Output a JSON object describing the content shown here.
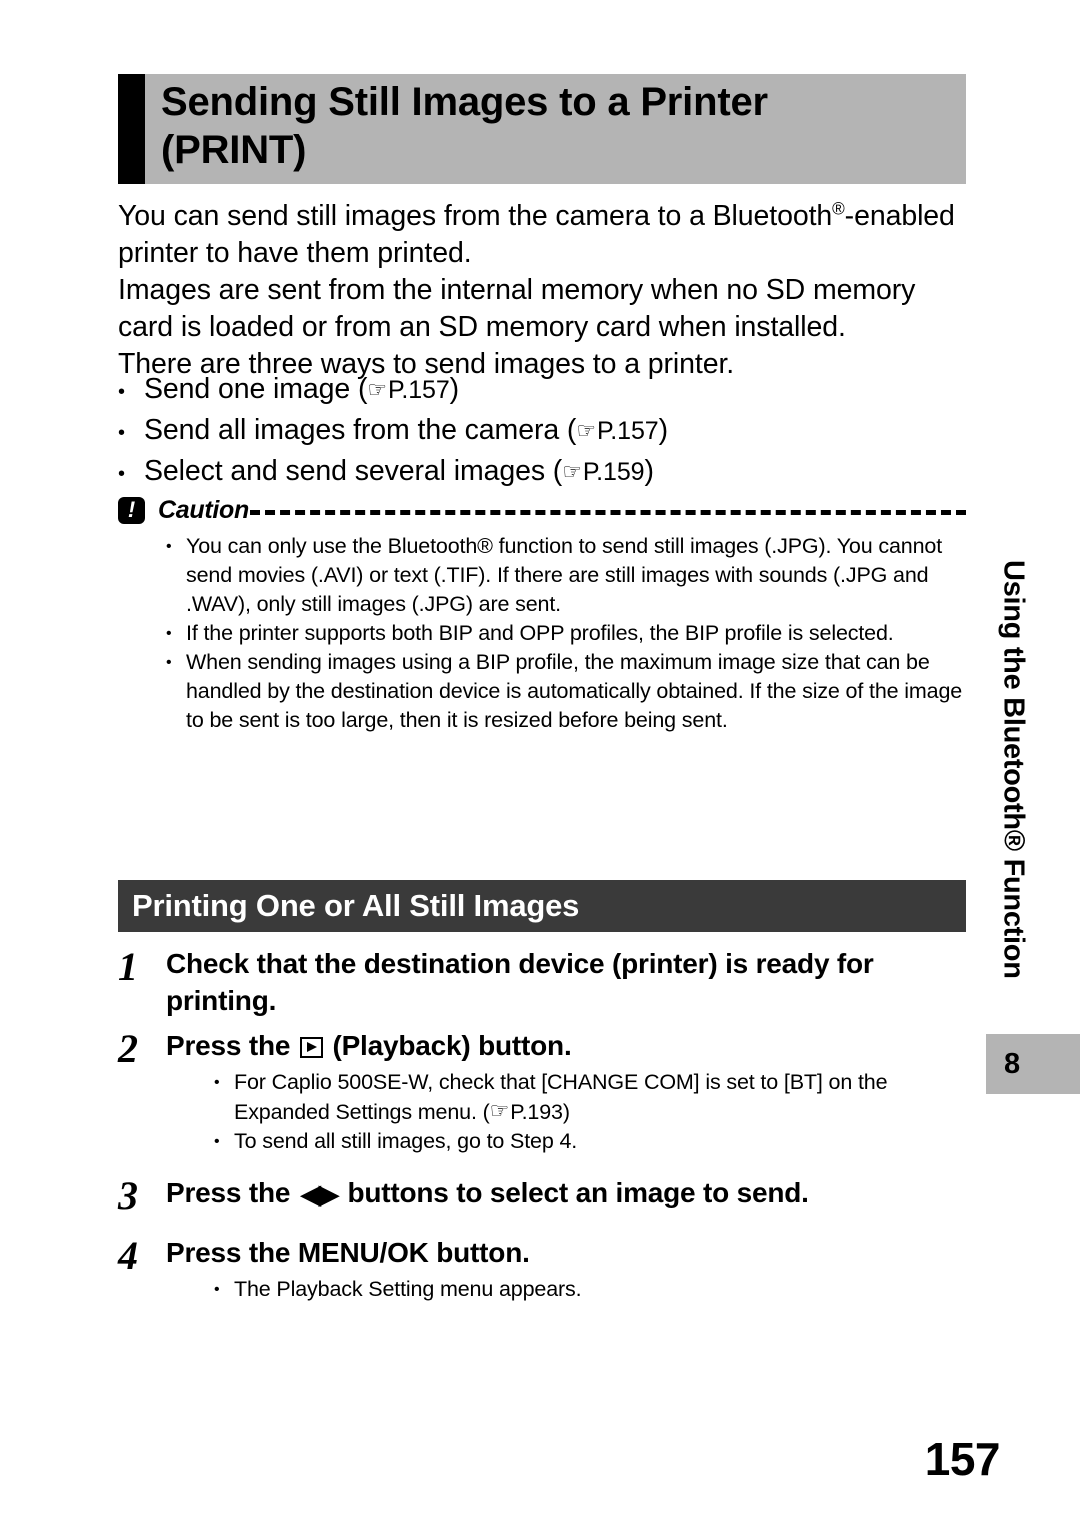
{
  "title": {
    "line1": "Sending Still Images to a Printer",
    "line2": "(PRINT)"
  },
  "intro": {
    "paragraph1_before_reg": "You can send still images from the camera to a Bluetooth",
    "registered_mark": "®",
    "paragraph1_after_reg": "-enabled printer to have them printed.",
    "paragraph2": "Images are sent from the internal memory when no SD memory card is loaded or from an SD memory card when installed.",
    "paragraph3": "There are three ways to send images to a printer."
  },
  "ref_list": {
    "bullet": "•",
    "xref_icon": "☞",
    "items": [
      {
        "text": "Send one image (",
        "page": "P.157",
        "close": ")"
      },
      {
        "text": "Send all images from the camera (",
        "page": "P.157",
        "close": ")"
      },
      {
        "text": "Select and send several images (",
        "page": "P.159",
        "close": ")"
      }
    ]
  },
  "caution": {
    "icon_glyph": "!",
    "title": "Caution",
    "bullet": "•",
    "items": [
      "You can only use the Bluetooth® function to send still images (.JPG). You cannot send movies (.AVI) or text (.TIF). If there are still images with sounds (.JPG and .WAV), only still images (.JPG) are sent.",
      "If the printer supports both BIP and OPP profiles, the BIP profile is selected.",
      "When sending images using a BIP profile, the maximum image size that can be handled by the destination device is automatically obtained. If the size of the image to be sent is too large, then it is resized before being sent."
    ]
  },
  "section": {
    "heading": "Printing One or All Still Images"
  },
  "steps": [
    {
      "number": "1",
      "title": "Check that the destination device (printer) is ready for printing.",
      "sub_items": []
    },
    {
      "number": "2",
      "title_before_icon": "Press the ",
      "icon": "playback-icon",
      "title_after_icon": " (Playback) button.",
      "sub_items": [
        {
          "text_before": "For Caplio 500SE-W, check that [CHANGE COM] is set to [BT] on the Expanded Settings menu. (",
          "xref_icon": "☞",
          "page": "P.193",
          "text_after": ")"
        },
        {
          "text_before": "To send all still images, go to Step 4.",
          "xref_icon": "",
          "page": "",
          "text_after": ""
        }
      ]
    },
    {
      "number": "3",
      "title_before_icon": "Press the ",
      "icon": "left-right-arrows-icon",
      "icon_glyph": "◀▶",
      "title_after_icon": " buttons to select an image to send.",
      "sub_items": []
    },
    {
      "number": "4",
      "title": "Press the MENU/OK button.",
      "sub_items": [
        {
          "text_before": "The Playback Setting menu appears.",
          "xref_icon": "",
          "page": "",
          "text_after": ""
        }
      ]
    }
  ],
  "side_tab": {
    "running_head": "Using the Bluetooth® Function",
    "chapter_number": "8"
  },
  "folio": {
    "page_number": "157"
  },
  "colors": {
    "title_band": "#b4b4b4",
    "title_accent": "#000000",
    "section_bar": "#3a3a3a",
    "chapter_tab": "#b4b4b4",
    "text": "#000000"
  }
}
